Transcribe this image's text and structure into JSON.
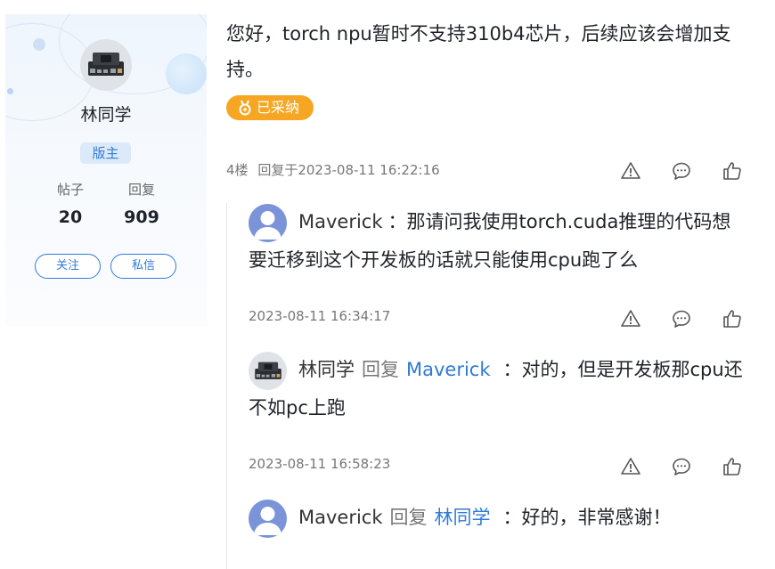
{
  "user_card": {
    "name": "林同学",
    "role": "版主",
    "stats": [
      {
        "label": "帖子",
        "value": "20"
      },
      {
        "label": "回复",
        "value": "909"
      }
    ],
    "follow_label": "关注",
    "message_label": "私信"
  },
  "post": {
    "text": "您好，torch npu暂时不支持310b4芯片，后续应该会增加支持。",
    "adopted_label": "已采纳",
    "floor": "4楼",
    "replied_at": "回复于2023-08-11 16:22:16"
  },
  "replies": [
    {
      "author": "Maverick",
      "reply_word": "",
      "reply_to": "",
      "colon": "：",
      "content": "那请问我使用torch.cuda推理的代码想要迁移到这个开发板的话就只能使用cpu跑了么",
      "time": "2023-08-11 16:34:17",
      "avatar": "default-avatar-icon"
    },
    {
      "author": "林同学",
      "reply_word": "回复",
      "reply_to": "Maverick",
      "colon": "：",
      "content": "对的，但是开发板那cpu还不如pc上跑",
      "time": "2023-08-11 16:58:23",
      "avatar": "dev-board-avatar"
    },
    {
      "author": "Maverick",
      "reply_word": "回复",
      "reply_to": "林同学",
      "colon": "：",
      "content": "好的，非常感谢！",
      "time": "",
      "avatar": "default-avatar-icon"
    }
  ],
  "actions": [
    "report-icon",
    "comment-icon",
    "like-icon"
  ],
  "colors": {
    "accent": "#2f7bd6",
    "adopted": "#f6a623",
    "meta": "#777777"
  }
}
